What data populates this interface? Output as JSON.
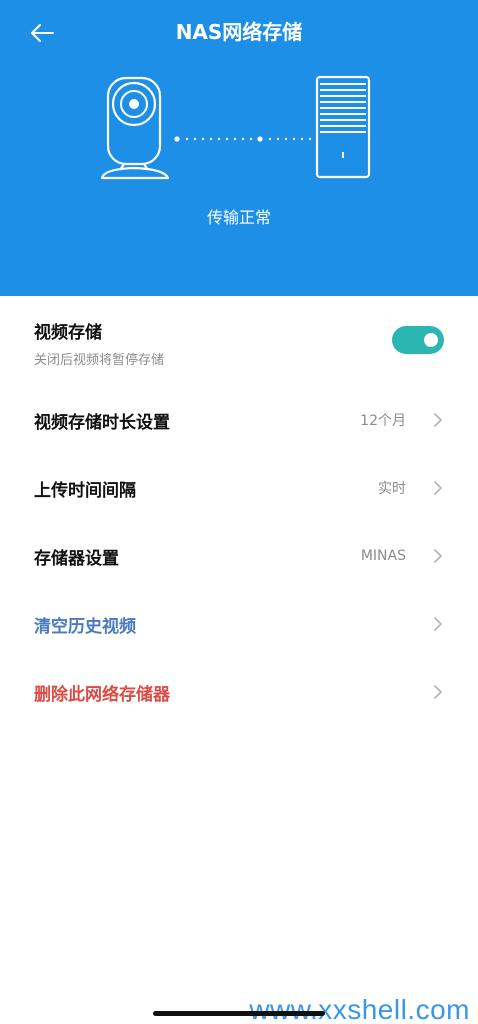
{
  "header": {
    "title": "NAS网络存储",
    "status": "传输正常",
    "background": "#1d8fe6"
  },
  "settings": {
    "video_storage": {
      "label": "视频存储",
      "subtitle": "关闭后视频将暂停存储",
      "enabled": true
    },
    "rows": [
      {
        "label": "视频存储时长设置",
        "value": "12个月"
      },
      {
        "label": "上传时间间隔",
        "value": "实时"
      },
      {
        "label": "存储器设置",
        "value": "MINAS"
      },
      {
        "label": "清空历史视频",
        "value": ""
      },
      {
        "label": "删除此网络存储器",
        "value": ""
      }
    ]
  },
  "colors": {
    "toggle_on": "#2bb6b1",
    "link_blue": "#4a7ac0",
    "danger_red": "#de4a44"
  },
  "watermark": "www.xxshell.com"
}
